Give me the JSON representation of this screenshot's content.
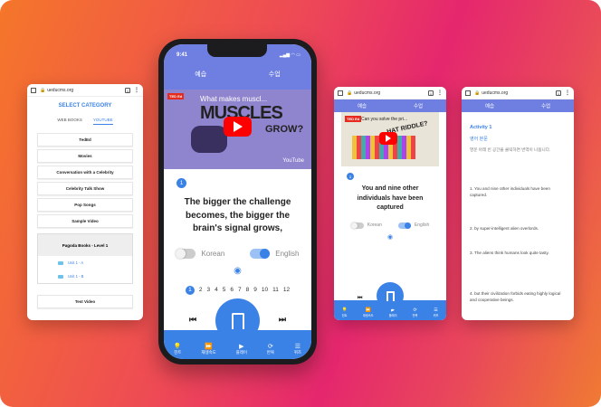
{
  "browser": {
    "url": "ueducms.org",
    "tabs_count": "1"
  },
  "card1": {
    "select_title": "SELECT CATEGORY",
    "tabs": [
      "WEB BOOKS",
      "YOUTUBE"
    ],
    "categories": [
      "TedEd",
      "Movies",
      "Conversation with a Celebrity",
      "Celebrity Talk Show",
      "Pop Songs",
      "Sample Video"
    ],
    "book": {
      "title": "Pagoda Books - Level 1",
      "units": [
        "Unit 1 - A",
        "Unit 1 - B"
      ]
    },
    "last_item": "Test Video"
  },
  "phone": {
    "time": "9:41",
    "tabs": [
      "예습",
      "수업"
    ],
    "video": {
      "badge": "TED Ed",
      "title": "What makes muscl...",
      "big_text": "MUSCLES",
      "grow": "GROW?",
      "brand": "YouTube"
    },
    "number": "1",
    "sentence": "The bigger the challenge becomes, the bigger the brain's signal grows,",
    "toggle_korean": "Korean",
    "toggle_english": "English",
    "pages": [
      "1",
      "2",
      "3",
      "4",
      "5",
      "6",
      "7",
      "8",
      "9",
      "10",
      "11",
      "12"
    ],
    "current_page": "1",
    "bottom": [
      "힌트",
      "재생속도",
      "플레이",
      "반복",
      "퀴즈"
    ]
  },
  "card3": {
    "tabs": [
      "예습",
      "수업"
    ],
    "video": {
      "badge": "TED Ed",
      "title": "Can you solve the pri...",
      "big_text": "HAT RIDDLE?"
    },
    "number": "1",
    "sentence": "You and nine other individuals have been captured",
    "toggle_korean": "Korean",
    "toggle_english": "English",
    "bottom": [
      "힌트",
      "재생속도",
      "플레이",
      "반복",
      "퀴즈"
    ]
  },
  "card4": {
    "tabs": [
      "예습",
      "수업"
    ],
    "activity": "Activity 1",
    "lang_label": "영어 본문",
    "instruction": "영문 아래 빈 공간을 클릭하면 번역이 나옵니다.",
    "sentences": [
      "1. You and nine other individuals have been captured.",
      "2. by super-intelligent alien overlords.",
      "3. The aliens think humans look quite tasty.",
      "4. but their civilization forbids eating highly logical and cooperative beings."
    ]
  },
  "colors": {
    "accent": "#3b82e6",
    "tabbar": "#6e7fe1"
  }
}
